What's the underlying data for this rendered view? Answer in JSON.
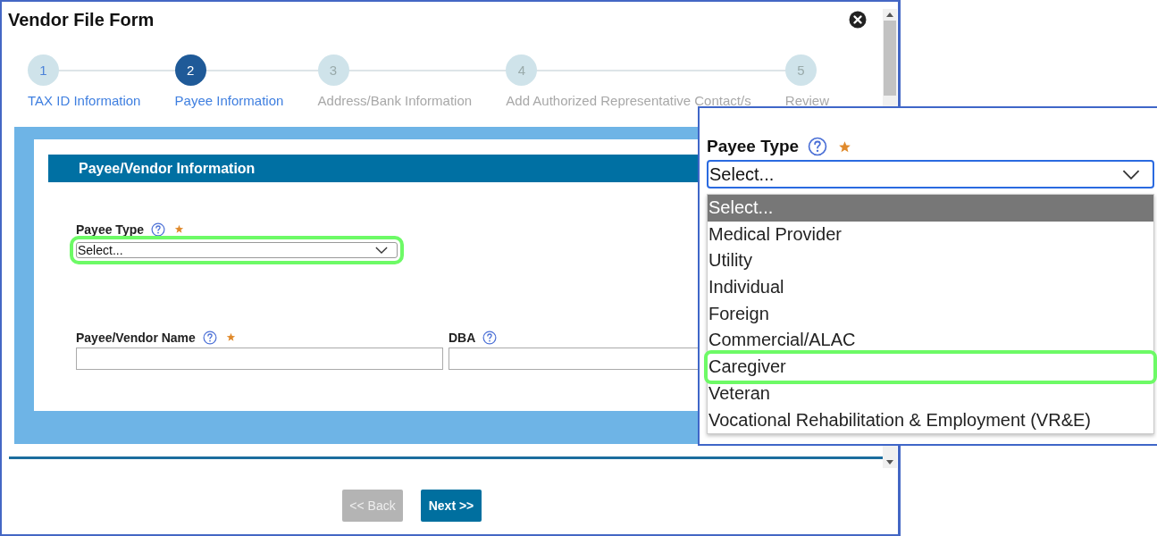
{
  "window": {
    "title": "Vendor File Form"
  },
  "steps": [
    {
      "number": "1",
      "label": "TAX ID Information",
      "selected": false,
      "completed": true
    },
    {
      "number": "2",
      "label": "Payee Information",
      "selected": true,
      "completed": false
    },
    {
      "number": "3",
      "label": "Address/Bank Information",
      "selected": false,
      "completed": false
    },
    {
      "number": "4",
      "label": "Add Authorized Representative Contact/s",
      "selected": false,
      "completed": false
    },
    {
      "number": "5",
      "label": "Review",
      "selected": false,
      "completed": false
    }
  ],
  "section": {
    "title": "Payee/Vendor Information"
  },
  "field_rows": [
    [
      {
        "kind": "select",
        "label": "Payee Type",
        "required": true,
        "value": "Select...",
        "highlighted": true
      }
    ],
    [
      {
        "kind": "text",
        "label": "Payee/Vendor Name",
        "required": true
      },
      {
        "kind": "text",
        "label": "DBA",
        "required": false
      }
    ]
  ],
  "buttons": [
    {
      "label": "<< Back",
      "disabled": true
    },
    {
      "label": "Next >>",
      "disabled": false
    }
  ],
  "callout": {
    "label": "Payee Type",
    "required": true,
    "value": "Select...",
    "options": [
      {
        "label": "Select...",
        "selected": true,
        "highlighted": false
      },
      {
        "label": "Medical Provider",
        "selected": false,
        "highlighted": false
      },
      {
        "label": "Utility",
        "selected": false,
        "highlighted": false
      },
      {
        "label": "Individual",
        "selected": false,
        "highlighted": false
      },
      {
        "label": "Foreign",
        "selected": false,
        "highlighted": false
      },
      {
        "label": "Commercial/ALAC",
        "selected": false,
        "highlighted": false
      },
      {
        "label": "Caregiver",
        "selected": false,
        "highlighted": true
      },
      {
        "label": "Veteran",
        "selected": false,
        "highlighted": false
      },
      {
        "label": "Vocational Rehabilitation & Employment (VR&E)",
        "selected": false,
        "highlighted": false
      }
    ]
  }
}
